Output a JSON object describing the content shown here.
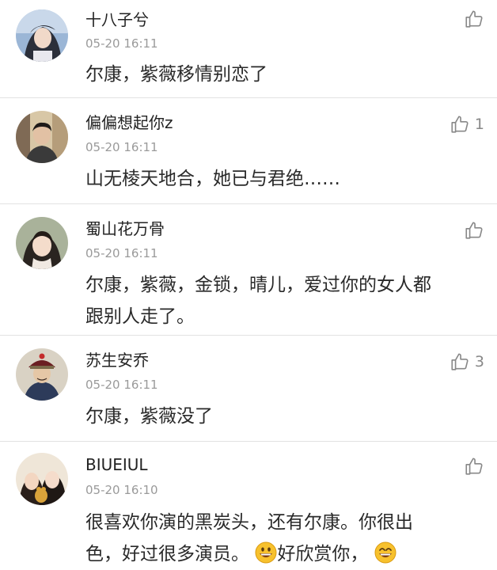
{
  "comments": [
    {
      "username": "十八子兮",
      "timestamp": "05-20 16:11",
      "text_lines": [
        "尔康，紫薇移情别恋了"
      ],
      "like_count": "",
      "avatar": "avatar-woman-icon"
    },
    {
      "username": "偏偏想起你z",
      "timestamp": "05-20 16:11",
      "text_lines": [
        "山无棱天地合，她已与君绝……"
      ],
      "like_count": "1",
      "avatar": "avatar-man-icon"
    },
    {
      "username": "蜀山花万骨",
      "timestamp": "05-20 16:11",
      "text_lines": [
        "尔康，紫薇，金锁，晴儿，爱过你的女人都",
        "跟别人走了。"
      ],
      "like_count": "",
      "avatar": "avatar-actress-icon"
    },
    {
      "username": "苏生安乔",
      "timestamp": "05-20 16:11",
      "text_lines": [
        "尔康，紫薇没了"
      ],
      "like_count": "3",
      "avatar": "avatar-official-icon"
    },
    {
      "username": "BIUEIUL",
      "timestamp": "05-20 16:10",
      "text_lines": [
        "很喜欢你演的黑炭头，还有尔康。你很出",
        "色，好过很多演员。",
        "好欣赏你，"
      ],
      "like_count": "",
      "avatar": "avatar-two-girls-icon"
    }
  ],
  "colors": {
    "text": "#2a2a2a",
    "meta": "#9a9a9a",
    "divider": "#e2e2e2",
    "like_icon": "#888888",
    "emoji": "#f7c12d"
  },
  "icons": {
    "like": "thumbs-up-icon",
    "emoji": "grinning-face-emoji-icon"
  }
}
